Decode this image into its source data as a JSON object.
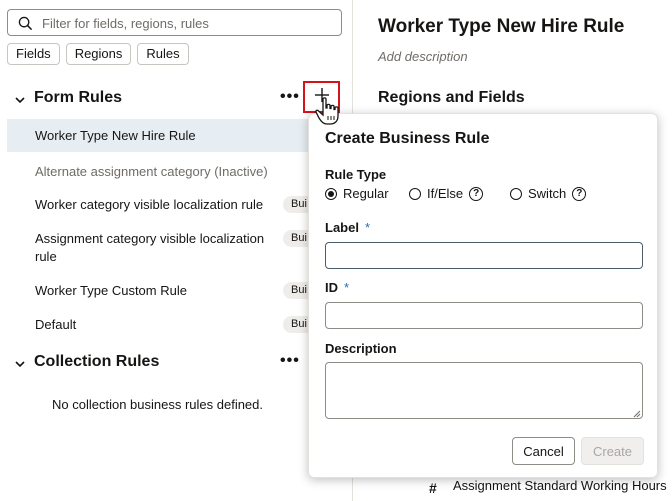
{
  "left_panel": {
    "search": {
      "placeholder": "Filter for fields, regions, rules"
    },
    "chips": [
      "Fields",
      "Regions",
      "Rules"
    ],
    "form_rules": {
      "title": "Form Rules",
      "more": "•••",
      "items": [
        {
          "label": "Worker Type New Hire Rule",
          "selected": true,
          "badge": ""
        },
        {
          "label": "Alternate assignment category (Inactive)",
          "inactive": true,
          "badge": ""
        },
        {
          "label": "Worker category visible localization rule",
          "badge": "Bui"
        },
        {
          "label": "Assignment category visible localization",
          "label2": "rule",
          "badge": "Bui"
        },
        {
          "label": "Worker Type Custom Rule",
          "badge": "Bui"
        },
        {
          "label": "Default",
          "badge": "Bui"
        }
      ]
    },
    "collection_rules": {
      "title": "Collection Rules",
      "more": "•••",
      "empty_message": "No collection business rules defined."
    }
  },
  "right_panel": {
    "title": "Worker Type New Hire Rule",
    "description_placeholder": "Add description",
    "regions_title": "Regions and Fields",
    "field_name": "Assignment Standard Working Hours",
    "field_icon": "#"
  },
  "popup": {
    "title": "Create Business Rule",
    "rule_type_label": "Rule Type",
    "rule_types": [
      {
        "label": "Regular",
        "selected": true
      },
      {
        "label": "If/Else",
        "help": "?"
      },
      {
        "label": "Switch",
        "help": "?"
      }
    ],
    "label_field": {
      "label": "Label",
      "required": "*",
      "value": ""
    },
    "id_field": {
      "label": "ID",
      "required": "*",
      "value": ""
    },
    "description_field": {
      "label": "Description",
      "value": ""
    },
    "cancel": "Cancel",
    "create": "Create"
  },
  "colors": {
    "highlight_border": "#d5131b",
    "selected_row": "#e7eef3",
    "required_marker": "#2b6cb0"
  }
}
